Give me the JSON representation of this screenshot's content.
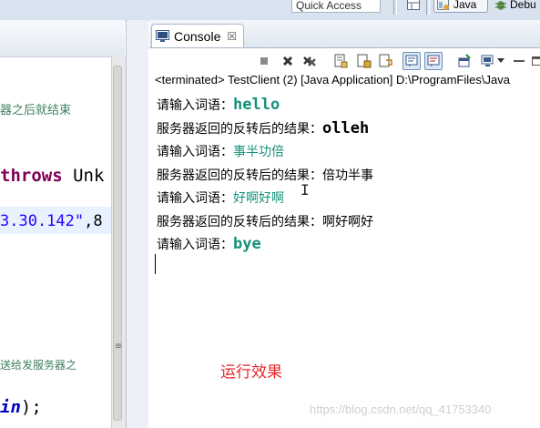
{
  "topbar": {
    "quick_access_placeholder": "Quick Access",
    "perspectives": [
      {
        "label": "Java",
        "active": true
      },
      {
        "label": "Debu",
        "active": false
      }
    ]
  },
  "editor": {
    "comment_line1": "器之后就结束",
    "throws_keyword": "throws",
    "throws_rest": " Unk",
    "ip_string": "3.30.142\"",
    "ip_rest": ",8",
    "comment_line2": "送给发服务器之",
    "in_field": "in",
    "in_rest": ");",
    "scroll_grip": "≡"
  },
  "console": {
    "tab_label": "Console",
    "close_glyph": "☒",
    "status": "<terminated> TestClient (2) [Java Application] D:\\ProgramFiles\\Java",
    "lines": [
      {
        "prompt": "请输入词语：",
        "input": "hello",
        "kind": "input",
        "script": "latin"
      },
      {
        "prompt": "服务器返回的反转后的结果：",
        "input": "olleh",
        "kind": "resp",
        "script": "latin"
      },
      {
        "prompt": "请输入词语：",
        "input": "事半功倍",
        "kind": "input",
        "script": "cjk"
      },
      {
        "prompt": "服务器返回的反转后的结果：",
        "input": "倍功半事",
        "kind": "resp",
        "script": "cjk"
      },
      {
        "prompt": "请输入词语：",
        "input": "好啊好啊",
        "kind": "input",
        "script": "cjk"
      },
      {
        "prompt": "服务器返回的反转后的结果：",
        "input": "啊好啊好",
        "kind": "resp",
        "script": "cjk"
      },
      {
        "prompt": "请输入词语：",
        "input": "bye",
        "kind": "input",
        "script": "latin"
      }
    ],
    "caption": "运行效果",
    "watermark": "https://blog.csdn.net/qq_41753340"
  },
  "colors": {
    "user_input": "#14917a",
    "caption": "#e8282c",
    "comment": "#3f7f5f",
    "keyword": "#7f0055",
    "string": "#2a00ff"
  },
  "icons": [
    "console-icon",
    "terminate-icon",
    "remove-launch-icon",
    "remove-all-icon",
    "clear-console-icon",
    "scroll-lock-icon",
    "word-wrap-icon",
    "show-on-stdout-icon",
    "show-on-stderr-icon",
    "pin-console-icon",
    "display-console-icon",
    "view-menu-icon",
    "minimize-icon",
    "maximize-icon"
  ]
}
